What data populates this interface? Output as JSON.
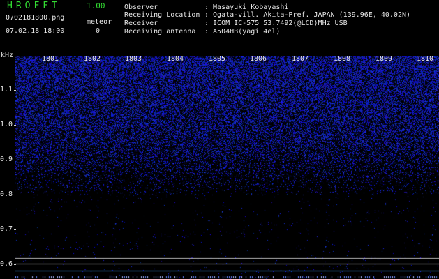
{
  "header": {
    "app_title": "HROFFT",
    "version": "1.00",
    "file_name": "0702181800.png",
    "meteor_label": "meteor",
    "datetime": "07.02.18 18:00",
    "meteor_count": "0"
  },
  "info": [
    {
      "label": "Observer",
      "value": ": Masayuki Kobayashi"
    },
    {
      "label": "Receiving Location",
      "value": ": Ogata-vill. Akita-Pref. JAPAN (139.96E, 40.02N)"
    },
    {
      "label": "Receiver",
      "value": ": ICOM IC-575 53.7492(@LCD)MHz USB"
    },
    {
      "label": "Receiving antenna",
      "value": ": A504HB(yagi 4el)"
    }
  ],
  "axis": {
    "unit": "kHz",
    "freq_labels": [
      "1.1",
      "1.0",
      "0.9",
      "0.8",
      "0.7",
      "0.6"
    ],
    "hour_labels": [
      "1801",
      "1802",
      "1803",
      "1804",
      "1805",
      "1806",
      "1807",
      "1808",
      "1809",
      "1810"
    ]
  },
  "colors": {
    "background": "#000000",
    "noise": "#3344ff",
    "header_green": "#33dd33",
    "header_yellow": "#ffff55"
  }
}
